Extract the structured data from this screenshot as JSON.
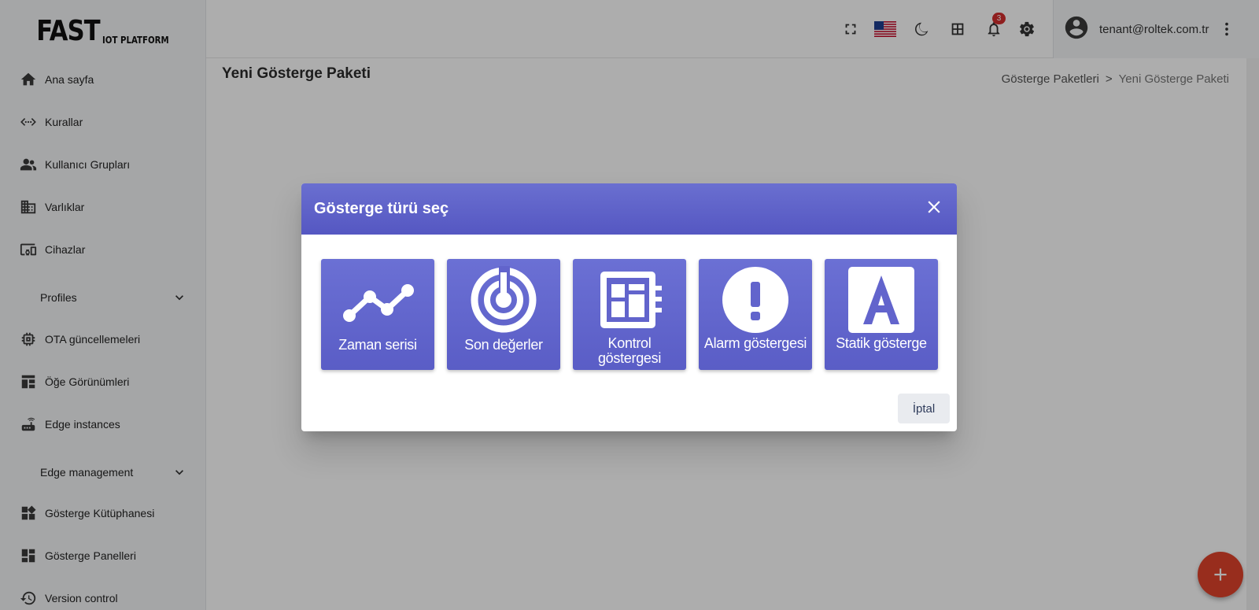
{
  "logo": {
    "main": "FAST",
    "sub": "IOT PLATFORM"
  },
  "sidebar": {
    "items": [
      {
        "label": "Ana sayfa",
        "icon": "home-icon"
      },
      {
        "label": "Kurallar",
        "icon": "code-arrows-icon"
      },
      {
        "label": "Kullanıcı Grupları",
        "icon": "people-icon"
      },
      {
        "label": "Varlıklar",
        "icon": "building-icon"
      },
      {
        "label": "Cihazlar",
        "icon": "devices-icon"
      },
      {
        "label": "Profiles",
        "icon": "chevron-down-icon",
        "section": true
      },
      {
        "label": "OTA güncellemeleri",
        "icon": "chip-icon"
      },
      {
        "label": "Öğe Görünümleri",
        "icon": "widgets-icon"
      },
      {
        "label": "Edge instances",
        "icon": "router-icon"
      },
      {
        "label": "Edge management",
        "icon": "chevron-down-icon",
        "section": true
      },
      {
        "label": "Gösterge Kütüphanesi",
        "icon": "widget-library-icon"
      },
      {
        "label": "Gösterge Panelleri",
        "icon": "dashboard-icon"
      },
      {
        "label": "Version control",
        "icon": "history-icon"
      }
    ]
  },
  "header": {
    "notification_count": "3",
    "user_email": "tenant@roltek.com.tr"
  },
  "page": {
    "title": "Yeni Gösterge Paketi",
    "breadcrumb": {
      "parent": "Gösterge Paketleri",
      "separator": ">",
      "current": "Yeni Gösterge Paketi"
    }
  },
  "dialog": {
    "title": "Gösterge türü seç",
    "tiles": [
      {
        "label": "Zaman serisi",
        "icon": "timeseries-icon"
      },
      {
        "label": "Son değerler",
        "icon": "latest-values-icon"
      },
      {
        "label": "Kontrol göstergesi",
        "icon": "control-widget-icon"
      },
      {
        "label": "Alarm göstergesi",
        "icon": "alarm-icon"
      },
      {
        "label": "Statik gösterge",
        "icon": "static-widget-icon"
      }
    ],
    "cancel_label": "İptal"
  },
  "colors": {
    "accent": "#5f63cb",
    "fab": "#e0432b",
    "badge": "#d32f2f"
  }
}
